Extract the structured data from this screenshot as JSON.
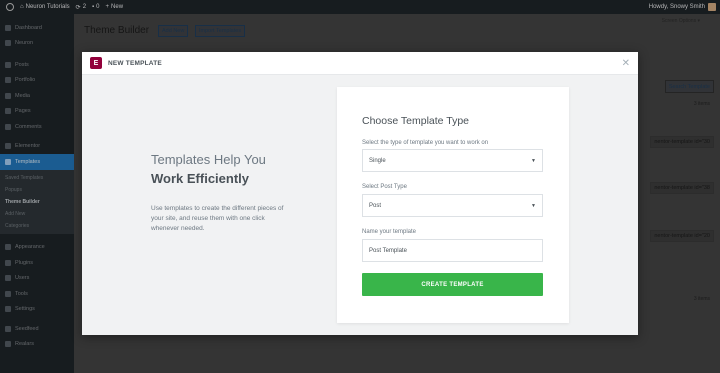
{
  "adminbar": {
    "site_name": "Neuron Tutorials",
    "updates_count": "2",
    "comments_count": "0",
    "new_label": "New",
    "howdy": "Howdy, Snowy Smith"
  },
  "sidebar": {
    "items": [
      {
        "label": "Dashboard"
      },
      {
        "label": "Neuron"
      },
      {
        "label": "Posts"
      },
      {
        "label": "Portfolio"
      },
      {
        "label": "Media"
      },
      {
        "label": "Pages"
      },
      {
        "label": "Comments"
      },
      {
        "label": "Elementor"
      },
      {
        "label": "Templates"
      }
    ],
    "submenu": [
      {
        "label": "Saved Templates"
      },
      {
        "label": "Popups"
      },
      {
        "label": "Theme Builder"
      },
      {
        "label": "Add New"
      },
      {
        "label": "Categories"
      }
    ],
    "items_after": [
      {
        "label": "Appearance"
      },
      {
        "label": "Plugins"
      },
      {
        "label": "Users"
      },
      {
        "label": "Tools"
      },
      {
        "label": "Settings"
      },
      {
        "label": "Seedfeed"
      },
      {
        "label": "Realars"
      }
    ]
  },
  "main": {
    "title": "Theme Builder",
    "add_new": "Add New",
    "import_templates": "Import Templates",
    "screen_options": "Screen Options ▾",
    "search_button": "Search Template",
    "items_count": "3 items",
    "shortcodes": [
      "nentor-template id=\"30",
      "nentor-template id=\"38",
      "nentor-template id=\"20"
    ]
  },
  "modal": {
    "header_title": "NEW TEMPLATE",
    "left_title_line1": "Templates Help You",
    "left_title_line2": "Work Efficiently",
    "left_description": "Use templates to create the different pieces of your site, and reuse them with one click whenever needed.",
    "form_title": "Choose Template Type",
    "type_label": "Select the type of template you want to work on",
    "type_value": "Single",
    "post_type_label": "Select Post Type",
    "post_type_value": "Post",
    "name_label": "Name your template",
    "name_value": "Post Template",
    "create_button": "CREATE TEMPLATE"
  },
  "colors": {
    "primary_button": "#39b54a",
    "elementor_logo": "#92003b",
    "active_menu": "#2271b1"
  }
}
